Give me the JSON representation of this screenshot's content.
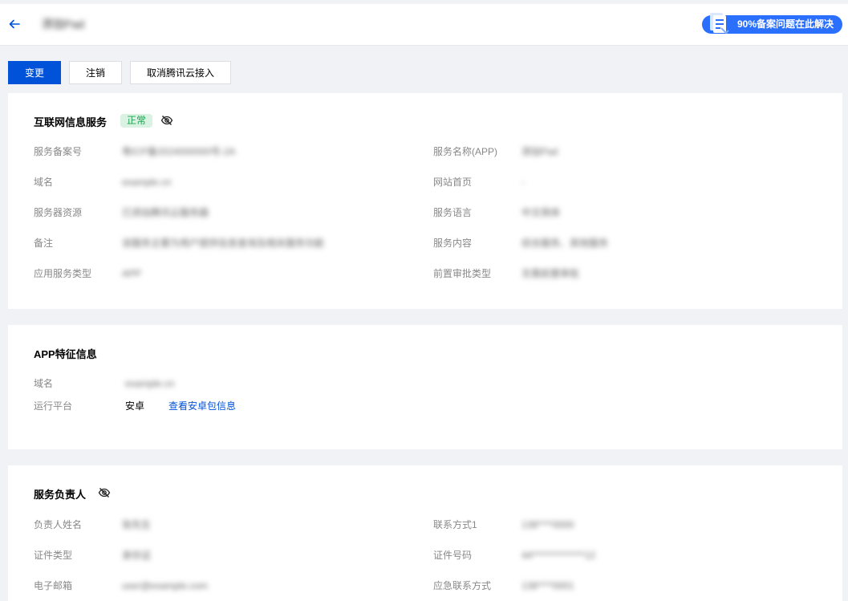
{
  "header": {
    "title": "添加Pad",
    "promo_text": "90%备案问题在此解决",
    "icons": [
      "arrow-left-icon",
      "document-icon"
    ]
  },
  "actions": {
    "change": "变更",
    "cancel": "注销",
    "cancel_access": "取消腾讯云接入"
  },
  "service": {
    "title": "互联网信息服务",
    "status": "正常",
    "left": [
      {
        "label": "服务备案号",
        "value": "粤ICP备2024000000号-2A"
      },
      {
        "label": "域名",
        "value": "example.cn"
      },
      {
        "label": "服务器资源",
        "value": "已添加腾讯云服务器"
      },
      {
        "label": "备注",
        "value": "该服务主要为用户提供信息查询及相关服务功能"
      },
      {
        "label": "应用服务类型",
        "value": "APP"
      }
    ],
    "right": [
      {
        "label": "服务名称(APP)",
        "value": "添加Pad"
      },
      {
        "label": "网站首页",
        "value": "-"
      },
      {
        "label": "服务语言",
        "value": "中文简体"
      },
      {
        "label": "服务内容",
        "value": "综合服务、其他服务"
      },
      {
        "label": "前置审批类型",
        "value": "无需前置审批"
      }
    ]
  },
  "app_info": {
    "title": "APP特征信息",
    "domain_label": "域名",
    "domain_value": "example.cn",
    "platform_label": "运行平台",
    "platform_value": "安卓",
    "platform_link": "查看安卓包信息"
  },
  "owner": {
    "title": "服务负责人",
    "left": [
      {
        "label": "负责人姓名",
        "value": "张先生"
      },
      {
        "label": "证件类型",
        "value": "身份证"
      },
      {
        "label": "电子邮箱",
        "value": "user@example.com"
      }
    ],
    "right": [
      {
        "label": "联系方式1",
        "value": "138****0000"
      },
      {
        "label": "证件号码",
        "value": "44**************12"
      },
      {
        "label": "应急联系方式",
        "value": "138****0001"
      }
    ]
  },
  "colors": {
    "primary": "#0052d9",
    "promo": "#2b6fff",
    "status_green": "#1fa352",
    "background": "#f1f2f5"
  }
}
